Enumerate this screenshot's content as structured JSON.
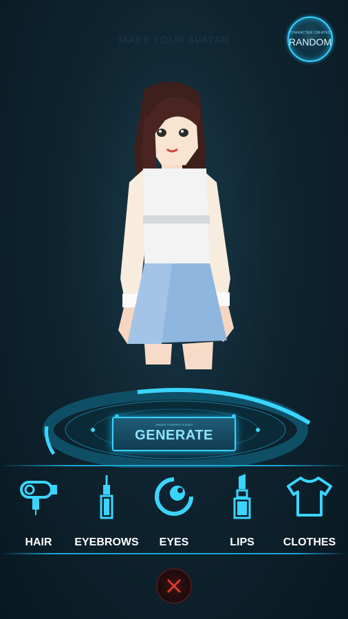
{
  "screen": {
    "title": "MAKE YOUR AVATAR"
  },
  "random_button": {
    "sublabel": "CHARACTER CREATED",
    "label": "RANDOM"
  },
  "generate_button": {
    "sublabel": "CREATE YOURSELF & BODY",
    "label": "GENERATE"
  },
  "menu": {
    "items": [
      {
        "label": "HAIR",
        "icon": "hair-dryer-icon"
      },
      {
        "label": "EYEBROWS",
        "icon": "eyebrow-pencil-icon"
      },
      {
        "label": "EYES",
        "icon": "eye-icon"
      },
      {
        "label": "LIPS",
        "icon": "lipstick-icon"
      },
      {
        "label": "CLOTHES",
        "icon": "tshirt-icon"
      }
    ]
  },
  "close_button": {
    "icon": "close-icon"
  },
  "colors": {
    "accent": "#3ad5ff",
    "background": "#0f2430",
    "close": "#e0372e"
  }
}
